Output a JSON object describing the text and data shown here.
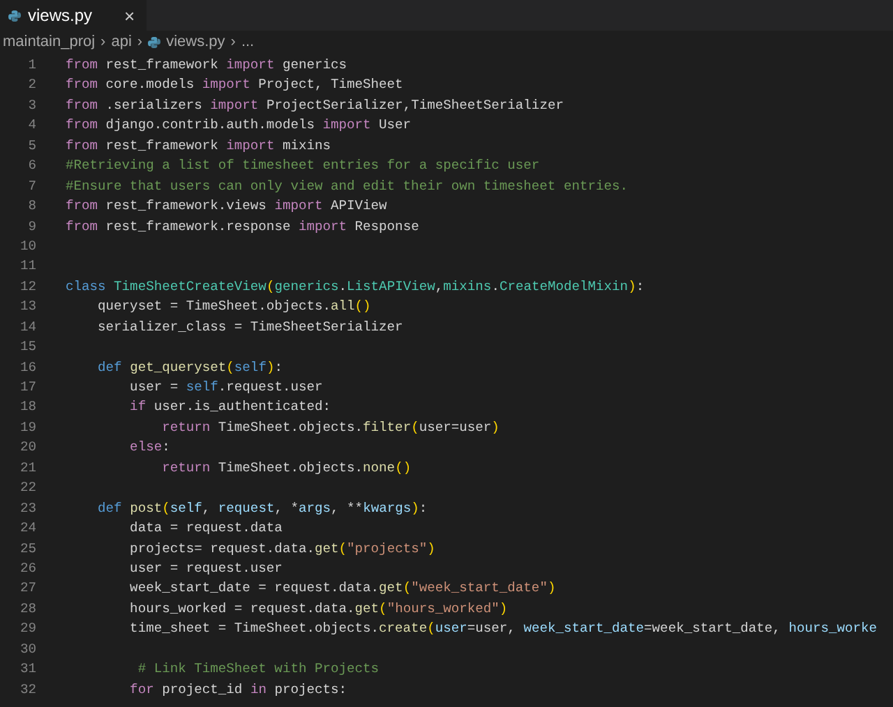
{
  "tab": {
    "title": "views.py",
    "close": "×",
    "selected": true
  },
  "breadcrumb": [
    {
      "text": "maintain_proj",
      "kind": "folder"
    },
    {
      "text": "api",
      "kind": "folder"
    },
    {
      "text": "views.py",
      "kind": "file"
    },
    {
      "text": "...",
      "kind": "more"
    }
  ],
  "separator": "›",
  "lines": [
    {
      "number": "1",
      "tokens": [
        {
          "kind": "kw",
          "text": "from"
        },
        {
          "kind": "tx",
          "text": " rest_framework "
        },
        {
          "kind": "kw",
          "text": "import"
        },
        {
          "kind": "tx",
          "text": " generics"
        }
      ]
    },
    {
      "number": "2",
      "tokens": [
        {
          "kind": "kw",
          "text": "from"
        },
        {
          "kind": "tx",
          "text": " core.models "
        },
        {
          "kind": "kw",
          "text": "import"
        },
        {
          "kind": "tx",
          "text": " Project, TimeSheet"
        }
      ]
    },
    {
      "number": "3",
      "tokens": [
        {
          "kind": "kw",
          "text": "from"
        },
        {
          "kind": "tx",
          "text": " .serializers "
        },
        {
          "kind": "kw",
          "text": "import"
        },
        {
          "kind": "tx",
          "text": " ProjectSerializer,TimeSheetSerializer"
        }
      ]
    },
    {
      "number": "4",
      "tokens": [
        {
          "kind": "kw",
          "text": "from"
        },
        {
          "kind": "tx",
          "text": " django.contrib.auth.models "
        },
        {
          "kind": "kw",
          "text": "import"
        },
        {
          "kind": "tx",
          "text": " User"
        }
      ]
    },
    {
      "number": "5",
      "tokens": [
        {
          "kind": "kw",
          "text": "from"
        },
        {
          "kind": "tx",
          "text": " rest_framework "
        },
        {
          "kind": "kw",
          "text": "import"
        },
        {
          "kind": "tx",
          "text": " mixins"
        }
      ]
    },
    {
      "number": "6",
      "tokens": [
        {
          "kind": "com",
          "text": "#Retrieving a list of timesheet entries for a specific user"
        }
      ]
    },
    {
      "number": "7",
      "tokens": [
        {
          "kind": "com",
          "text": "#Ensure that users can only view and edit their own timesheet entries."
        }
      ]
    },
    {
      "number": "8",
      "tokens": [
        {
          "kind": "kw",
          "text": "from"
        },
        {
          "kind": "tx",
          "text": " rest_framework.views "
        },
        {
          "kind": "kw",
          "text": "import"
        },
        {
          "kind": "tx",
          "text": " APIView"
        }
      ]
    },
    {
      "number": "9",
      "tokens": [
        {
          "kind": "kw",
          "text": "from"
        },
        {
          "kind": "tx",
          "text": " rest_framework.response "
        },
        {
          "kind": "kw",
          "text": "import"
        },
        {
          "kind": "tx",
          "text": " Response"
        }
      ]
    },
    {
      "number": "10"
    },
    {
      "number": "11"
    },
    {
      "number": "12",
      "tokens": [
        {
          "kind": "st",
          "text": "class "
        },
        {
          "kind": "cls",
          "text": "TimeSheetCreateView"
        },
        {
          "kind": "p",
          "text": "("
        },
        {
          "kind": "cls",
          "text": "generics"
        },
        {
          "kind": "tx",
          "text": "."
        },
        {
          "kind": "cls",
          "text": "ListAPIView"
        },
        {
          "kind": "tx",
          "text": ","
        },
        {
          "kind": "cls",
          "text": "mixins"
        },
        {
          "kind": "tx",
          "text": "."
        },
        {
          "kind": "cls",
          "text": "CreateModelMixin"
        },
        {
          "kind": "p",
          "text": ")"
        },
        {
          "kind": "tx",
          "text": ":"
        }
      ]
    },
    {
      "number": "13",
      "tokens": [
        {
          "kind": "tx",
          "text": "    queryset = TimeSheet.objects."
        },
        {
          "kind": "fn",
          "text": "all"
        },
        {
          "kind": "p",
          "text": "()"
        }
      ]
    },
    {
      "number": "14",
      "tokens": [
        {
          "kind": "tx",
          "text": "    serializer_class = TimeSheetSerializer"
        }
      ]
    },
    {
      "number": "15"
    },
    {
      "number": "16",
      "tokens": [
        {
          "kind": "st",
          "text": "    def "
        },
        {
          "kind": "fn",
          "text": "get_queryset"
        },
        {
          "kind": "p",
          "text": "("
        },
        {
          "kind": "st",
          "text": "self"
        },
        {
          "kind": "p",
          "text": ")"
        },
        {
          "kind": "tx",
          "text": ":"
        }
      ]
    },
    {
      "number": "17",
      "tokens": [
        {
          "kind": "tx",
          "text": "        user = "
        },
        {
          "kind": "st",
          "text": "self"
        },
        {
          "kind": "tx",
          "text": ".request.user"
        }
      ]
    },
    {
      "number": "18",
      "tokens": [
        {
          "kind": "kw",
          "text": "        if"
        },
        {
          "kind": "tx",
          "text": " user.is_authenticated:"
        }
      ]
    },
    {
      "number": "19",
      "tokens": [
        {
          "kind": "kw",
          "text": "            return"
        },
        {
          "kind": "tx",
          "text": " TimeSheet.objects."
        },
        {
          "kind": "fn",
          "text": "filter"
        },
        {
          "kind": "p",
          "text": "("
        },
        {
          "kind": "tx",
          "text": "user=user"
        },
        {
          "kind": "p",
          "text": ")"
        }
      ]
    },
    {
      "number": "20",
      "tokens": [
        {
          "kind": "kw",
          "text": "        else"
        },
        {
          "kind": "tx",
          "text": ":"
        }
      ]
    },
    {
      "number": "21",
      "tokens": [
        {
          "kind": "kw",
          "text": "            return"
        },
        {
          "kind": "tx",
          "text": " TimeSheet.objects."
        },
        {
          "kind": "fn",
          "text": "none"
        },
        {
          "kind": "p",
          "text": "()"
        }
      ]
    },
    {
      "number": "22"
    },
    {
      "number": "23",
      "tokens": [
        {
          "kind": "st",
          "text": "    def "
        },
        {
          "kind": "fn",
          "text": "post"
        },
        {
          "kind": "p",
          "text": "("
        },
        {
          "kind": "var",
          "text": "self"
        },
        {
          "kind": "tx",
          "text": ", "
        },
        {
          "kind": "var",
          "text": "request"
        },
        {
          "kind": "tx",
          "text": ", *"
        },
        {
          "kind": "var",
          "text": "args"
        },
        {
          "kind": "tx",
          "text": ", **"
        },
        {
          "kind": "var",
          "text": "kwargs"
        },
        {
          "kind": "p",
          "text": ")"
        },
        {
          "kind": "tx",
          "text": ":"
        }
      ]
    },
    {
      "number": "24",
      "tokens": [
        {
          "kind": "tx",
          "text": "        data = request.data"
        }
      ]
    },
    {
      "number": "25",
      "tokens": [
        {
          "kind": "tx",
          "text": "        projects= request.data."
        },
        {
          "kind": "fn",
          "text": "get"
        },
        {
          "kind": "p",
          "text": "("
        },
        {
          "kind": "str",
          "text": "\"projects\""
        },
        {
          "kind": "p",
          "text": ")"
        }
      ]
    },
    {
      "number": "26",
      "tokens": [
        {
          "kind": "tx",
          "text": "        user = request.user"
        }
      ]
    },
    {
      "number": "27",
      "tokens": [
        {
          "kind": "tx",
          "text": "        week_start_date = request.data."
        },
        {
          "kind": "fn",
          "text": "get"
        },
        {
          "kind": "p",
          "text": "("
        },
        {
          "kind": "str",
          "text": "\"week_start_date\""
        },
        {
          "kind": "p",
          "text": ")"
        }
      ]
    },
    {
      "number": "28",
      "tokens": [
        {
          "kind": "tx",
          "text": "        hours_worked = request.data."
        },
        {
          "kind": "fn",
          "text": "get"
        },
        {
          "kind": "p",
          "text": "("
        },
        {
          "kind": "str",
          "text": "\"hours_worked\""
        },
        {
          "kind": "p",
          "text": ")"
        }
      ]
    },
    {
      "number": "29",
      "tokens": [
        {
          "kind": "tx",
          "text": "        time_sheet = TimeSheet.objects."
        },
        {
          "kind": "fn",
          "text": "create"
        },
        {
          "kind": "p",
          "text": "("
        },
        {
          "kind": "var",
          "text": "user"
        },
        {
          "kind": "tx",
          "text": "=user, "
        },
        {
          "kind": "var",
          "text": "week_start_date"
        },
        {
          "kind": "tx",
          "text": "=week_start_date, "
        },
        {
          "kind": "var",
          "text": "hours_worke"
        }
      ]
    },
    {
      "number": "30"
    },
    {
      "number": "31",
      "tokens": [
        {
          "kind": "com",
          "text": "         # Link TimeSheet with Projects"
        }
      ]
    },
    {
      "number": "32",
      "tokens": [
        {
          "kind": "kw",
          "text": "        for"
        },
        {
          "kind": "tx",
          "text": " project_id "
        },
        {
          "kind": "kw",
          "text": "in"
        },
        {
          "kind": "tx",
          "text": " projects:"
        }
      ]
    }
  ]
}
